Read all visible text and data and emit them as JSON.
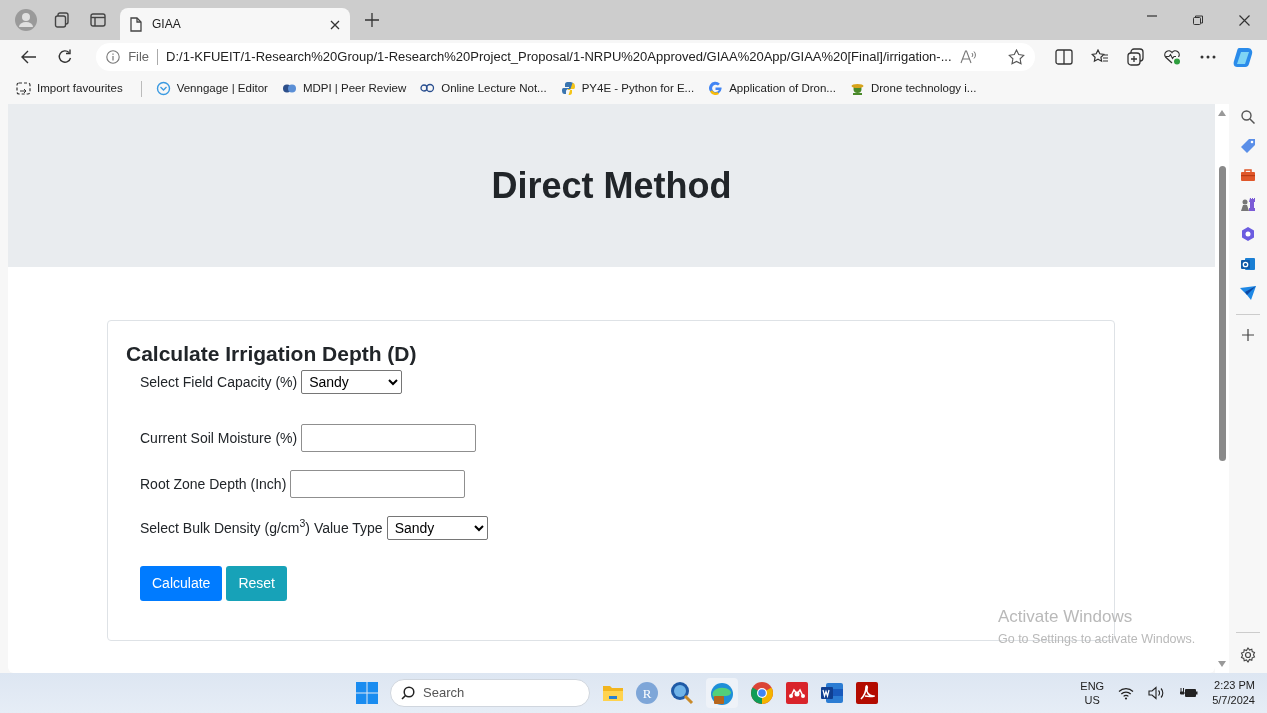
{
  "browser": {
    "tabs": [
      {
        "title": "GIAA",
        "selected": true
      }
    ],
    "address": {
      "scheme": "File",
      "url": "D:/1-KFUEIT/1-Research%20Group/1-Research%20Project_Proposal/1-NRPU%20Approved/GIAA%20App/GIAA%20[Final]/irrigation-..."
    },
    "bookmarks": [
      {
        "label": "Import favourites",
        "kind": "import"
      },
      {
        "label": "Venngage | Editor",
        "kind": "venngage"
      },
      {
        "label": "MDPI | Peer Review",
        "kind": "mdpi"
      },
      {
        "label": "Online Lecture Not...",
        "kind": "geo"
      },
      {
        "label": "PY4E - Python for E...",
        "kind": "python"
      },
      {
        "label": "Application of Dron...",
        "kind": "google"
      },
      {
        "label": "Drone technology i...",
        "kind": "drone"
      }
    ]
  },
  "page": {
    "heading": "Direct Method",
    "form": {
      "title": "Calculate Irrigation Depth (D)",
      "fields": [
        {
          "kind": "select",
          "label": "Select Field Capacity (%)",
          "value": "Sandy"
        },
        {
          "kind": "input",
          "label": "Current Soil Moisture (%)"
        },
        {
          "kind": "input",
          "label": "Root Zone Depth (Inch)"
        },
        {
          "kind": "select",
          "label": "Select Bulk Density (g/cm$^{3}$) Value Type",
          "value": "Sandy"
        }
      ],
      "buttons": [
        {
          "label": "Calculate",
          "kind": "primary"
        },
        {
          "label": "Reset",
          "kind": "info"
        }
      ]
    }
  },
  "activation_notice": {
    "title": "Activate Windows",
    "text": "Go to Settings to activate Windows."
  },
  "taskbar": {
    "search_placeholder": "Search",
    "r_app_letter": "R",
    "language": "ENG",
    "region": "US",
    "time": "2:23 PM",
    "date": "5/7/2024"
  }
}
